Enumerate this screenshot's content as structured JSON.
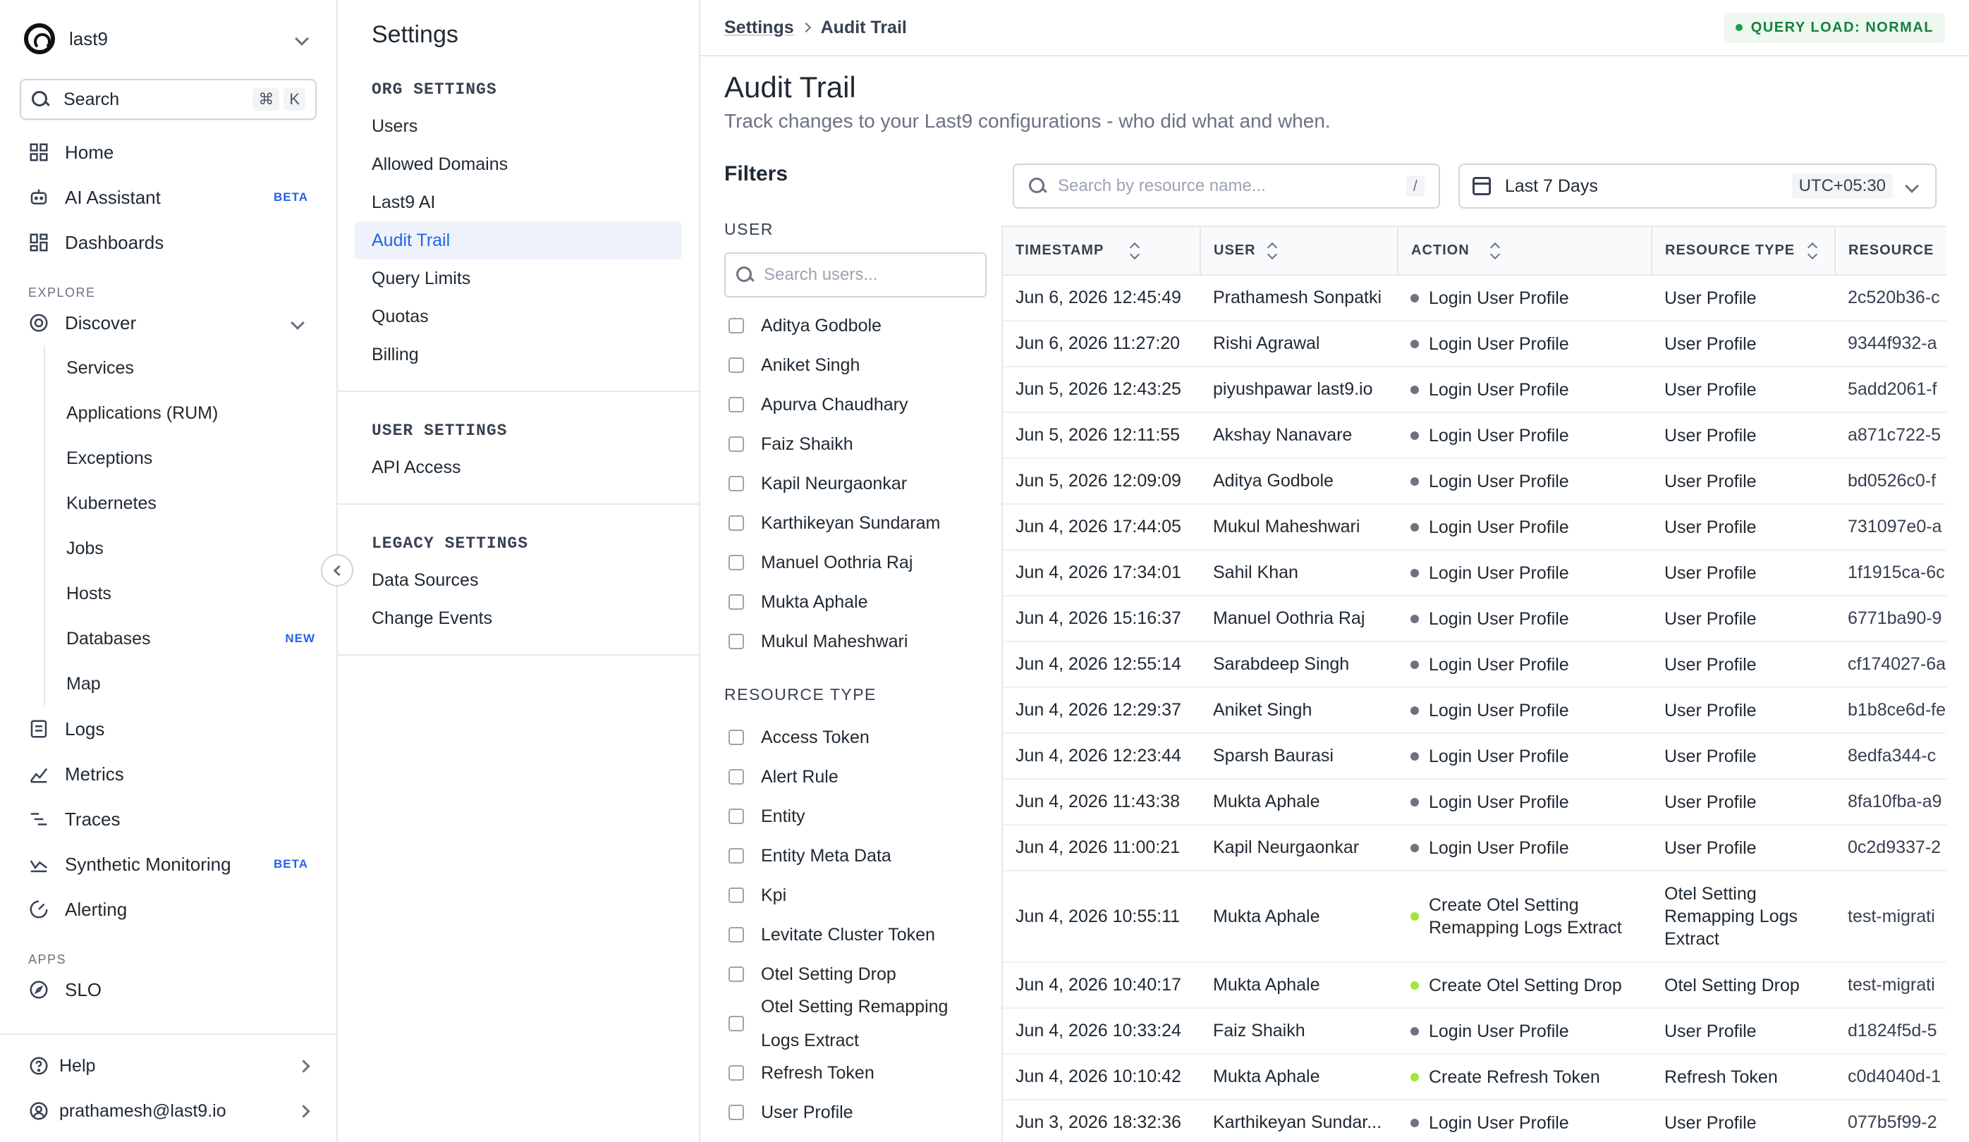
{
  "org": {
    "name": "last9"
  },
  "search": {
    "label": "Search",
    "shortcut_1": "⌘",
    "shortcut_2": "K"
  },
  "nav": {
    "home": "Home",
    "ai_assistant": "AI Assistant",
    "ai_badge": "BETA",
    "dashboards": "Dashboards",
    "explore_label": "EXPLORE",
    "discover": "Discover",
    "discover_items": [
      "Services",
      "Applications (RUM)",
      "Exceptions",
      "Kubernetes",
      "Jobs",
      "Hosts",
      "Databases",
      "Map"
    ],
    "databases_badge": "NEW",
    "logs": "Logs",
    "metrics": "Metrics",
    "traces": "Traces",
    "synthetic": "Synthetic Monitoring",
    "synthetic_badge": "BETA",
    "alerting": "Alerting",
    "apps_label": "APPS",
    "slo": "SLO",
    "help": "Help",
    "user": "prathamesh@last9.io"
  },
  "settings": {
    "title": "Settings",
    "org_head": "ORG SETTINGS",
    "org_items": [
      "Users",
      "Allowed Domains",
      "Last9 AI",
      "Audit Trail",
      "Query Limits",
      "Quotas",
      "Billing"
    ],
    "user_head": "USER SETTINGS",
    "user_items": [
      "API Access"
    ],
    "legacy_head": "LEGACY SETTINGS",
    "legacy_items": [
      "Data Sources",
      "Change Events"
    ]
  },
  "breadcrumb": {
    "root": "Settings",
    "current": "Audit Trail"
  },
  "query_load": "QUERY LOAD: NORMAL",
  "page": {
    "title": "Audit Trail",
    "description": "Track changes to your Last9 configurations - who did what and when."
  },
  "filters": {
    "title": "Filters",
    "user_label": "USER",
    "user_search_placeholder": "Search users...",
    "users": [
      "Aditya Godbole",
      "Aniket Singh",
      "Apurva Chaudhary",
      "Faiz Shaikh",
      "Kapil Neurgaonkar",
      "Karthikeyan Sundaram",
      "Manuel Oothria Raj",
      "Mukta Aphale",
      "Mukul Maheshwari"
    ],
    "resource_label": "RESOURCE TYPE",
    "resources": [
      "Access Token",
      "Alert Rule",
      "Entity",
      "Entity Meta Data",
      "Kpi",
      "Levitate Cluster Token",
      "Otel Setting Drop",
      "Otel Setting Remapping Logs Extract",
      "Refresh Token",
      "User Profile"
    ]
  },
  "toolbar": {
    "search_placeholder": "Search by resource name...",
    "search_shortcut": "/",
    "range_label": "Last 7 Days",
    "timezone": "UTC+05:30"
  },
  "table": {
    "headers": [
      "TIMESTAMP",
      "USER",
      "ACTION",
      "RESOURCE TYPE",
      "RESOURCE"
    ],
    "rows": [
      {
        "ts": "Jun 6, 2026 12:45:49",
        "user": "Prathamesh Sonpatki",
        "action": "Login User Profile",
        "kind": "login",
        "type": "User Profile",
        "res": "2c520b36-c"
      },
      {
        "ts": "Jun 6, 2026 11:27:20",
        "user": "Rishi Agrawal",
        "action": "Login User Profile",
        "kind": "login",
        "type": "User Profile",
        "res": "9344f932-a"
      },
      {
        "ts": "Jun 5, 2026 12:43:25",
        "user": "piyushpawar last9.io",
        "action": "Login User Profile",
        "kind": "login",
        "type": "User Profile",
        "res": "5add2061-f"
      },
      {
        "ts": "Jun 5, 2026 12:11:55",
        "user": "Akshay Nanavare",
        "action": "Login User Profile",
        "kind": "login",
        "type": "User Profile",
        "res": "a871c722-5"
      },
      {
        "ts": "Jun 5, 2026 12:09:09",
        "user": "Aditya Godbole",
        "action": "Login User Profile",
        "kind": "login",
        "type": "User Profile",
        "res": "bd0526c0-f"
      },
      {
        "ts": "Jun 4, 2026 17:44:05",
        "user": "Mukul Maheshwari",
        "action": "Login User Profile",
        "kind": "login",
        "type": "User Profile",
        "res": "731097e0-a"
      },
      {
        "ts": "Jun 4, 2026 17:34:01",
        "user": "Sahil Khan",
        "action": "Login User Profile",
        "kind": "login",
        "type": "User Profile",
        "res": "1f1915ca-6c"
      },
      {
        "ts": "Jun 4, 2026 15:16:37",
        "user": "Manuel Oothria Raj",
        "action": "Login User Profile",
        "kind": "login",
        "type": "User Profile",
        "res": "6771ba90-9"
      },
      {
        "ts": "Jun 4, 2026 12:55:14",
        "user": "Sarabdeep Singh",
        "action": "Login User Profile",
        "kind": "login",
        "type": "User Profile",
        "res": "cf174027-6a"
      },
      {
        "ts": "Jun 4, 2026 12:29:37",
        "user": "Aniket Singh",
        "action": "Login User Profile",
        "kind": "login",
        "type": "User Profile",
        "res": "b1b8ce6d-fe"
      },
      {
        "ts": "Jun 4, 2026 12:23:44",
        "user": "Sparsh Baurasi",
        "action": "Login User Profile",
        "kind": "login",
        "type": "User Profile",
        "res": "8edfa344-c"
      },
      {
        "ts": "Jun 4, 2026 11:43:38",
        "user": "Mukta Aphale",
        "action": "Login User Profile",
        "kind": "login",
        "type": "User Profile",
        "res": "8fa10fba-a9"
      },
      {
        "ts": "Jun 4, 2026 11:00:21",
        "user": "Kapil Neurgaonkar",
        "action": "Login User Profile",
        "kind": "login",
        "type": "User Profile",
        "res": "0c2d9337-2"
      },
      {
        "ts": "Jun 4, 2026 10:55:11",
        "user": "Mukta Aphale",
        "action": "Create Otel Setting Remapping Logs Extract",
        "kind": "create",
        "type": "Otel Setting Remapping Logs Extract",
        "res": "test-migrati"
      },
      {
        "ts": "Jun 4, 2026 10:40:17",
        "user": "Mukta Aphale",
        "action": "Create Otel Setting Drop",
        "kind": "create",
        "type": "Otel Setting Drop",
        "res": "test-migrati"
      },
      {
        "ts": "Jun 4, 2026 10:33:24",
        "user": "Faiz Shaikh",
        "action": "Login User Profile",
        "kind": "login",
        "type": "User Profile",
        "res": "d1824f5d-5"
      },
      {
        "ts": "Jun 4, 2026 10:10:42",
        "user": "Mukta Aphale",
        "action": "Create Refresh Token",
        "kind": "create",
        "type": "Refresh Token",
        "res": "c0d4040d-1"
      },
      {
        "ts": "Jun 3, 2026 18:32:36",
        "user": "Karthikeyan Sundar...",
        "action": "Login User Profile",
        "kind": "login",
        "type": "User Profile",
        "res": "077b5f99-2"
      }
    ]
  },
  "colors": {
    "accent": "#2563eb",
    "status_ok": "#16a34a",
    "create_dot": "#a3e635",
    "login_dot": "#6b7280"
  }
}
